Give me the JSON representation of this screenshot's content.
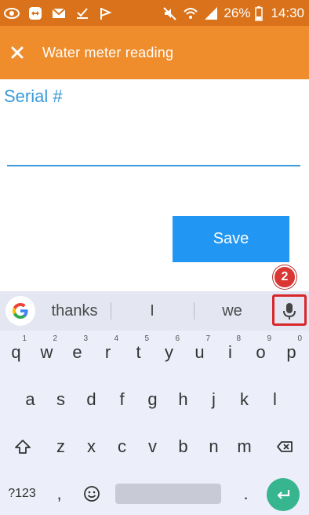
{
  "status_bar": {
    "battery_percent": "26%",
    "time": "14:30",
    "icons": [
      "eye-icon",
      "teamviewer-icon",
      "gmail-icon",
      "download-done-icon",
      "flag-icon",
      "mute-icon",
      "wifi-icon",
      "signal-icon",
      "battery-icon"
    ]
  },
  "app_bar": {
    "title": "Water meter reading",
    "close_icon": "close-icon",
    "color": "#ef8c2b"
  },
  "form": {
    "serial_label": "Serial #",
    "serial_value": "",
    "save_label": "Save",
    "accent_color": "#2196f3"
  },
  "annotation": {
    "step_number": "2"
  },
  "keyboard": {
    "suggestions": [
      "thanks",
      "I",
      "we"
    ],
    "rows": [
      [
        {
          "label": "q",
          "hint": "1"
        },
        {
          "label": "w",
          "hint": "2"
        },
        {
          "label": "e",
          "hint": "3"
        },
        {
          "label": "r",
          "hint": "4"
        },
        {
          "label": "t",
          "hint": "5"
        },
        {
          "label": "y",
          "hint": "6"
        },
        {
          "label": "u",
          "hint": "7"
        },
        {
          "label": "i",
          "hint": "8"
        },
        {
          "label": "o",
          "hint": "9"
        },
        {
          "label": "p",
          "hint": "0"
        }
      ],
      [
        {
          "label": "a"
        },
        {
          "label": "s"
        },
        {
          "label": "d"
        },
        {
          "label": "f"
        },
        {
          "label": "g"
        },
        {
          "label": "h"
        },
        {
          "label": "j"
        },
        {
          "label": "k"
        },
        {
          "label": "l"
        }
      ],
      [
        {
          "label": "z"
        },
        {
          "label": "x"
        },
        {
          "label": "c"
        },
        {
          "label": "v"
        },
        {
          "label": "b"
        },
        {
          "label": "n"
        },
        {
          "label": "m"
        }
      ]
    ],
    "symbols_key": "?123",
    "comma_key": ",",
    "period_key": ".",
    "enter_color": "#37b58e"
  }
}
